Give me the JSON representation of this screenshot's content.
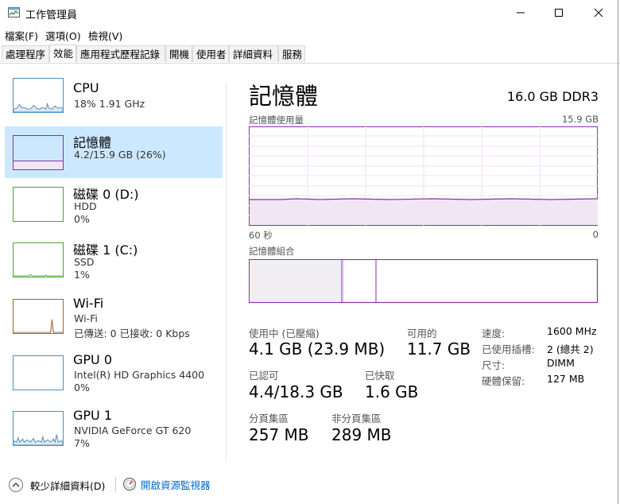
{
  "window": {
    "title": "工作管理員"
  },
  "menu": [
    "檔案(F)",
    "選項(O)",
    "檢視(V)"
  ],
  "tabs": [
    "處理程序",
    "效能",
    "應用程式歷程記錄",
    "開機",
    "使用者",
    "詳細資料",
    "服務"
  ],
  "sidebar": [
    {
      "name": "CPU",
      "line1": "18%  1.91 GHz",
      "line2": "",
      "color": "#4a90c2",
      "selected": false
    },
    {
      "name": "記憶體",
      "line1": "4.2/15.9 GB (26%)",
      "line2": "",
      "color": "#8b2fa8",
      "selected": true
    },
    {
      "name": "磁碟 0 (D:)",
      "line1": "HDD",
      "line2": "0%",
      "color": "#4aa52e",
      "selected": false
    },
    {
      "name": "磁碟 1 (C:)",
      "line1": "SSD",
      "line2": "1%",
      "color": "#4aa52e",
      "selected": false
    },
    {
      "name": "Wi-Fi",
      "line1": "Wi-Fi",
      "line2": "已傳送: 0 已接收: 0 Kbps",
      "color": "#a8612d",
      "selected": false
    },
    {
      "name": "GPU 0",
      "line1": "Intel(R) HD Graphics 4400",
      "line2": "0%",
      "color": "#4a90c2",
      "selected": false
    },
    {
      "name": "GPU 1",
      "line1": "NVIDIA GeForce GT 620",
      "line2": "7%",
      "color": "#4a90c2",
      "selected": false
    }
  ],
  "main": {
    "title": "記憶體",
    "spec": "16.0 GB DDR3",
    "usage_label": "記憶體使用量",
    "usage_max": "15.9 GB",
    "time_left": "60 秒",
    "time_right": "0",
    "composition_label": "記憶體組合",
    "usage_percent": 26,
    "in_use_label": "使用中 (已壓縮)",
    "in_use_value": "4.1 GB (23.9 MB)",
    "available_label": "可用的",
    "available_value": "11.7 GB",
    "committed_label": "已認可",
    "committed_value": "4.4/18.3 GB",
    "cached_label": "已快取",
    "cached_value": "1.6 GB",
    "paged_label": "分頁集區",
    "paged_value": "257 MB",
    "nonpaged_label": "非分頁集區",
    "nonpaged_value": "289 MB",
    "details": [
      {
        "label": "速度:",
        "value": "1600 MHz"
      },
      {
        "label": "已使用插槽:",
        "value": "2 (總共 2)"
      },
      {
        "label": "尺寸:",
        "value": "DIMM"
      },
      {
        "label": "硬體保留:",
        "value": "127 MB"
      }
    ]
  },
  "footer": {
    "fewer_details": "較少詳細資料(D)",
    "resource_monitor": "開啟資源監視器"
  },
  "colors": {
    "memory": "#8b2fa8",
    "link": "#0066cc",
    "selected_bg": "#cce8ff"
  }
}
